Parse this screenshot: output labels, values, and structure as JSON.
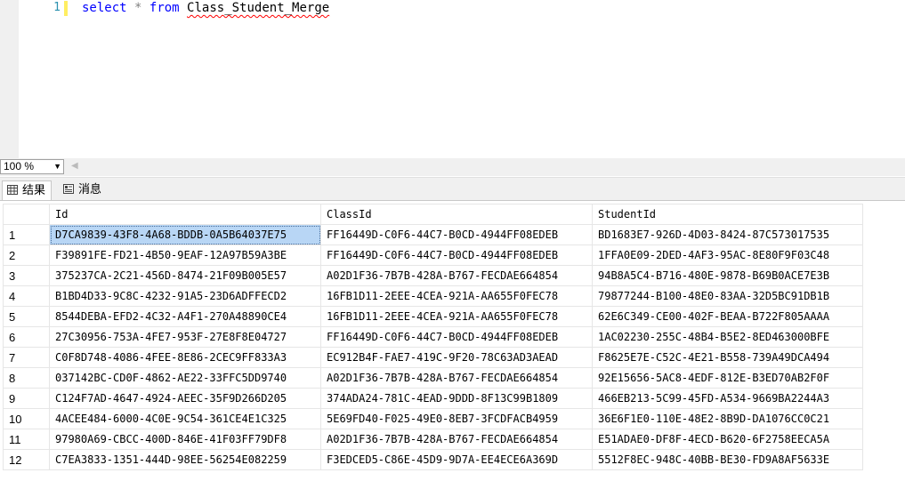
{
  "editor": {
    "line_number": "1",
    "tokens": {
      "kw_select": "select",
      "op_star": "*",
      "kw_from": "from",
      "table_name": "Class_Student_Merge"
    }
  },
  "zoom": {
    "value": "100 %"
  },
  "tabs": [
    {
      "label": "结果",
      "icon": "grid-icon"
    },
    {
      "label": "消息",
      "icon": "messages-icon"
    }
  ],
  "grid": {
    "columns": [
      "Id",
      "ClassId",
      "StudentId"
    ],
    "rows": [
      {
        "n": "1",
        "id": "D7CA9839-43F8-4A68-BDDB-0A5B64037E75",
        "classid": "FF16449D-C0F6-44C7-B0CD-4944FF08EDEB",
        "studentid": "BD1683E7-926D-4D03-8424-87C573017535"
      },
      {
        "n": "2",
        "id": "F39891FE-FD21-4B50-9EAF-12A97B59A3BE",
        "classid": "FF16449D-C0F6-44C7-B0CD-4944FF08EDEB",
        "studentid": "1FFA0E09-2DED-4AF3-95AC-8E80F9F03C48"
      },
      {
        "n": "3",
        "id": "375237CA-2C21-456D-8474-21F09B005E57",
        "classid": "A02D1F36-7B7B-428A-B767-FECDAE664854",
        "studentid": "94B8A5C4-B716-480E-9878-B69B0ACE7E3B"
      },
      {
        "n": "4",
        "id": "B1BD4D33-9C8C-4232-91A5-23D6ADFFECD2",
        "classid": "16FB1D11-2EEE-4CEA-921A-AA655F0FEC78",
        "studentid": "79877244-B100-48E0-83AA-32D5BC91DB1B"
      },
      {
        "n": "5",
        "id": "8544DEBA-EFD2-4C32-A4F1-270A48890CE4",
        "classid": "16FB1D11-2EEE-4CEA-921A-AA655F0FEC78",
        "studentid": "62E6C349-CE00-402F-BEAA-B722F805AAAA"
      },
      {
        "n": "6",
        "id": "27C30956-753A-4FE7-953F-27E8F8E04727",
        "classid": "FF16449D-C0F6-44C7-B0CD-4944FF08EDEB",
        "studentid": "1AC02230-255C-48B4-B5E2-8ED463000BFE"
      },
      {
        "n": "7",
        "id": "C0F8D748-4086-4FEE-8E86-2CEC9FF833A3",
        "classid": "EC912B4F-FAE7-419C-9F20-78C63AD3AEAD",
        "studentid": "F8625E7E-C52C-4E21-B558-739A49DCA494"
      },
      {
        "n": "8",
        "id": "037142BC-CD0F-4862-AE22-33FFC5DD9740",
        "classid": "A02D1F36-7B7B-428A-B767-FECDAE664854",
        "studentid": "92E15656-5AC8-4EDF-812E-B3ED70AB2F0F"
      },
      {
        "n": "9",
        "id": "C124F7AD-4647-4924-AEEC-35F9D266D205",
        "classid": "374ADA24-781C-4EAD-9DDD-8F13C99B1809",
        "studentid": "466EB213-5C99-45FD-A534-9669BA2244A3"
      },
      {
        "n": "10",
        "id": "4ACEE484-6000-4C0E-9C54-361CE4E1C325",
        "classid": "5E69FD40-F025-49E0-8EB7-3FCDFACB4959",
        "studentid": "36E6F1E0-110E-48E2-8B9D-DA1076CC0C21"
      },
      {
        "n": "11",
        "id": "97980A69-CBCC-400D-846E-41F03FF79DF8",
        "classid": "A02D1F36-7B7B-428A-B767-FECDAE664854",
        "studentid": "E51ADAE0-DF8F-4ECD-B620-6F2758EECA5A"
      },
      {
        "n": "12",
        "id": "C7EA3833-1351-444D-98EE-56254E082259",
        "classid": "F3EDCED5-C86E-45D9-9D7A-EE4ECE6A369D",
        "studentid": "5512F8EC-948C-40BB-BE30-FD9A8AF5633E"
      }
    ]
  },
  "colors": {
    "keyword": "#0000ff",
    "line_number": "#2b91af",
    "selection": "#b8d6f5"
  }
}
